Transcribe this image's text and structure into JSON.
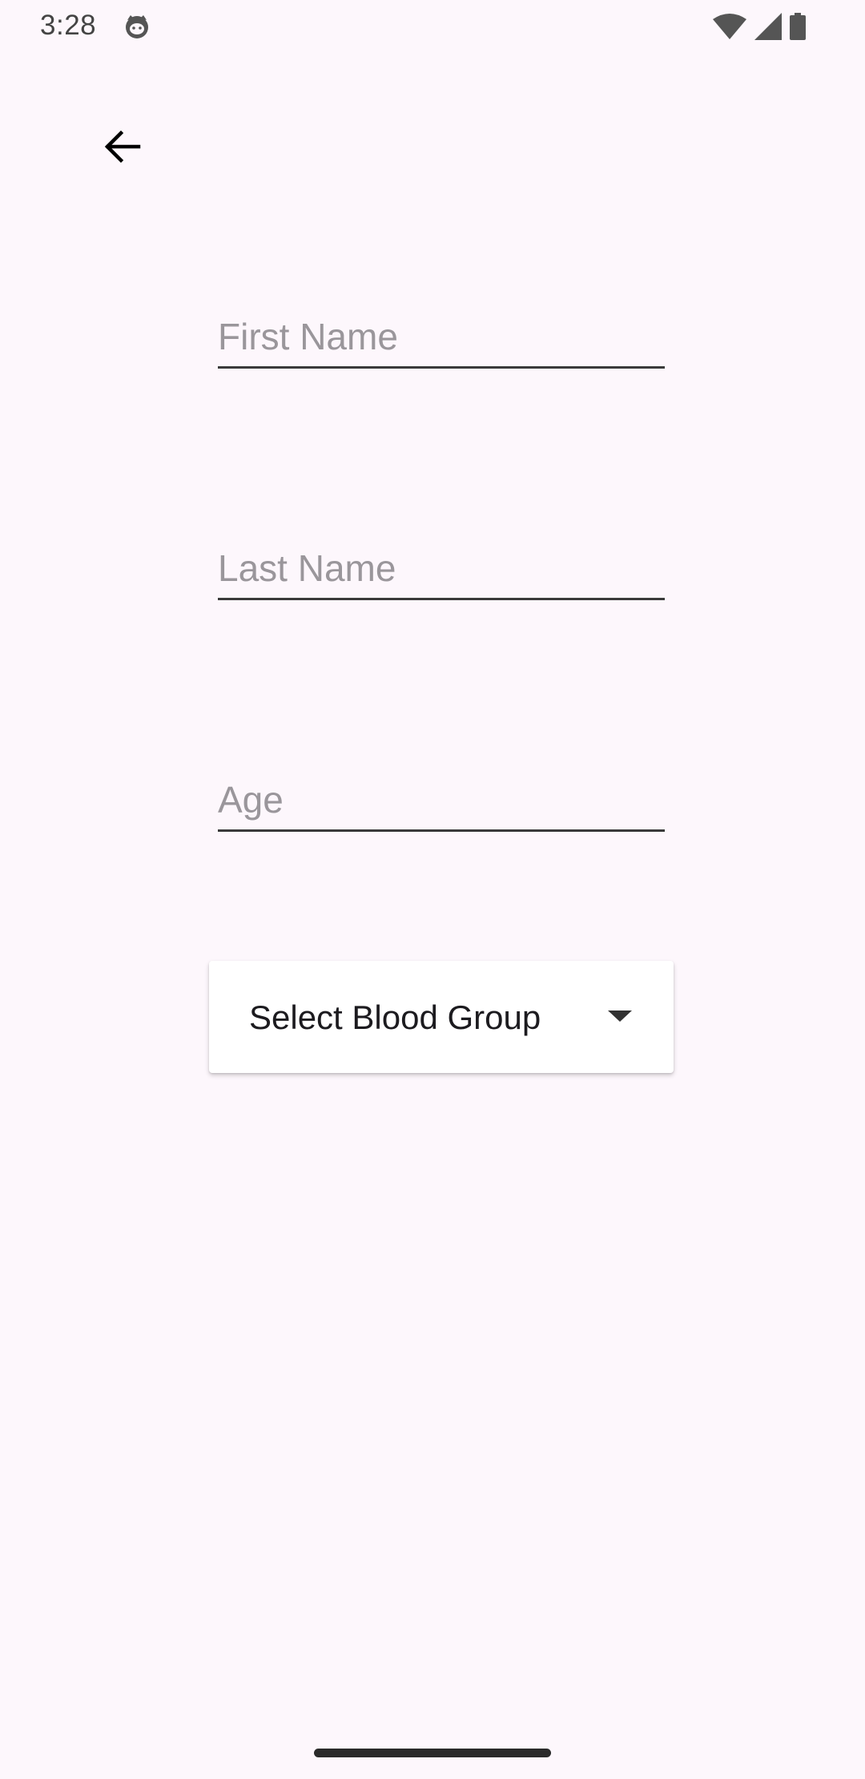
{
  "status_bar": {
    "time": "3:28",
    "app_icon": "cat-face-icon",
    "wifi_icon": "wifi-icon",
    "signal_icon": "cell-signal-icon",
    "battery_icon": "battery-icon"
  },
  "toolbar": {
    "back_icon": "arrow-back-icon"
  },
  "form": {
    "first_name": {
      "value": "",
      "placeholder": "First Name"
    },
    "last_name": {
      "value": "",
      "placeholder": "Last Name"
    },
    "age": {
      "value": "",
      "placeholder": "Age"
    },
    "blood_group": {
      "selected_label": "Select Blood Group",
      "caret_icon": "caret-down-icon"
    }
  },
  "colors": {
    "background": "#fdf7fc",
    "underline": "#3a3a3a",
    "placeholder": "#9a969b",
    "dropdown_bg": "#ffffff"
  }
}
